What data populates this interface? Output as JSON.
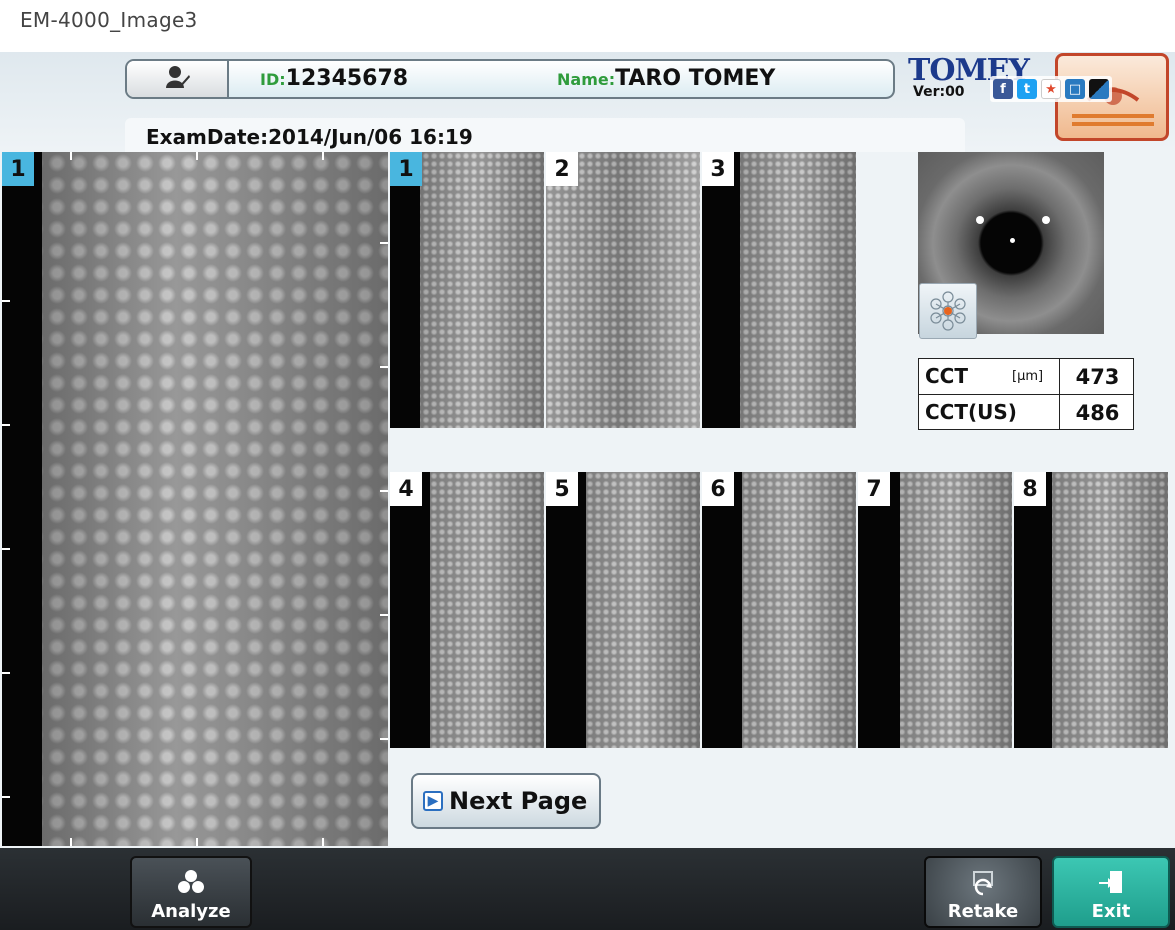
{
  "page_caption": "EM-4000_Image3",
  "header": {
    "patient_button_icon": "patient-icon",
    "id_key": "ID:",
    "id_value": "12345678",
    "name_key": "Name:",
    "name_value": "TARO TOMEY",
    "brand": "TOMEY",
    "version": "Ver:00",
    "exam_date": "ExamDate:2014/Jun/06 16:19",
    "eye_badge_icon": "eye-side-icon",
    "social_icons": [
      "facebook-icon",
      "twitter-icon",
      "share-icon",
      "linkedin-icon",
      "delicious-icon"
    ]
  },
  "main_image": {
    "index": "1",
    "selected": true
  },
  "top_thumbnails": [
    {
      "index": "1",
      "selected": true
    },
    {
      "index": "2",
      "selected": false
    },
    {
      "index": "3",
      "selected": false
    }
  ],
  "bottom_thumbnails": [
    {
      "index": "4"
    },
    {
      "index": "5"
    },
    {
      "index": "6"
    },
    {
      "index": "7"
    },
    {
      "index": "8"
    }
  ],
  "pupil": {
    "locator_icon": "capture-area-locator-icon"
  },
  "cct_table": {
    "rows": [
      {
        "label": "CCT",
        "unit": "[μm]",
        "value": "473"
      },
      {
        "label": "CCT(US)",
        "unit": "",
        "value": "486"
      }
    ]
  },
  "next_page": {
    "label": "Next Page",
    "icon": "arrow-right-icon"
  },
  "toolbar": {
    "analyze_label": "Analyze",
    "analyze_icon": "analyze-icon",
    "retake_label": "Retake",
    "retake_icon": "retake-icon",
    "exit_label": "Exit",
    "exit_icon": "exit-door-icon"
  },
  "colors": {
    "selected_index": "#49b6df",
    "id_name_keys": "#2f9c3c",
    "brand": "#1c3a8c",
    "exit_button": "#2bb6a2",
    "eye_badge_border": "#c2462a"
  }
}
